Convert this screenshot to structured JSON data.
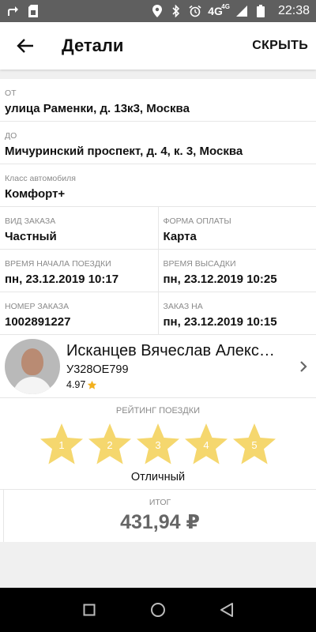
{
  "status_bar": {
    "network": "4G",
    "network_sup": "4G",
    "time": "22:38",
    "icons": [
      "share-icon",
      "sim-icon",
      "location-icon",
      "bluetooth-icon",
      "alarm-icon",
      "signal-icon",
      "battery-icon"
    ]
  },
  "header": {
    "title": "Детали",
    "hide_label": "СКРЫТЬ"
  },
  "trip": {
    "from_label": "ОТ",
    "from_value": "улица Раменки, д. 13к3, Москва",
    "to_label": "ДО",
    "to_value": "Мичуринский проспект, д. 4, к. 3, Москва",
    "class_label": "Класс автомобиля",
    "class_value": "Комфорт+",
    "order_type_label": "ВИД ЗАКАЗА",
    "order_type_value": "Частный",
    "payment_label": "ФОРМА ОПЛАТЫ",
    "payment_value": "Карта",
    "start_label": "ВРЕМЯ НАЧАЛА ПОЕЗДКИ",
    "start_value": "пн, 23.12.2019 10:17",
    "dropoff_label": "ВРЕМЯ ВЫСАДКИ",
    "dropoff_value": "пн, 23.12.2019 10:25",
    "order_num_label": "НОМЕР ЗАКАЗА",
    "order_num_value": "1002891227",
    "ordered_for_label": "ЗАКАЗ НА",
    "ordered_for_value": "пн, 23.12.2019 10:15"
  },
  "driver": {
    "name": "Исканцев Вячеслав Алекс…",
    "car_plate": "У328ОЕ799",
    "rating": "4.97"
  },
  "trip_rating": {
    "title": "РЕЙТИНГ ПОЕЗДКИ",
    "stars": [
      "1",
      "2",
      "3",
      "4",
      "5"
    ],
    "selected": 5,
    "result_text": "Отличный"
  },
  "total": {
    "label": "ИТОГ",
    "value": "431,94 ₽"
  },
  "colors": {
    "star": "#f5d76e",
    "rating_star": "#f2b01e",
    "status_bar": "#5f5f5f"
  }
}
